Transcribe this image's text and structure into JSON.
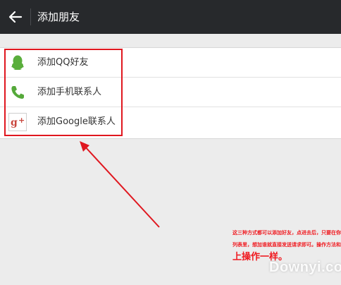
{
  "header": {
    "back_icon": "arrow-left-icon",
    "title": "添加朋友",
    "background": "#27292c"
  },
  "options": [
    {
      "icon": "qq-penguin-icon",
      "label": "添加QQ好友",
      "color": "#5aae3c"
    },
    {
      "icon": "phone-icon",
      "label": "添加手机联系人",
      "color": "#55a93a"
    },
    {
      "icon": "google-plus-icon",
      "label": "添加Google联系人",
      "color": "#c9463d"
    }
  ],
  "annotation": {
    "lines": [
      "这三种方式都可以添加好友，点进去后，只要在你的好友",
      "列表里，想加谁就直接发送请求即可。操作方法和在手机",
      "上操作一样。"
    ],
    "color": "#f0191f"
  },
  "watermark": "Downyi.com"
}
